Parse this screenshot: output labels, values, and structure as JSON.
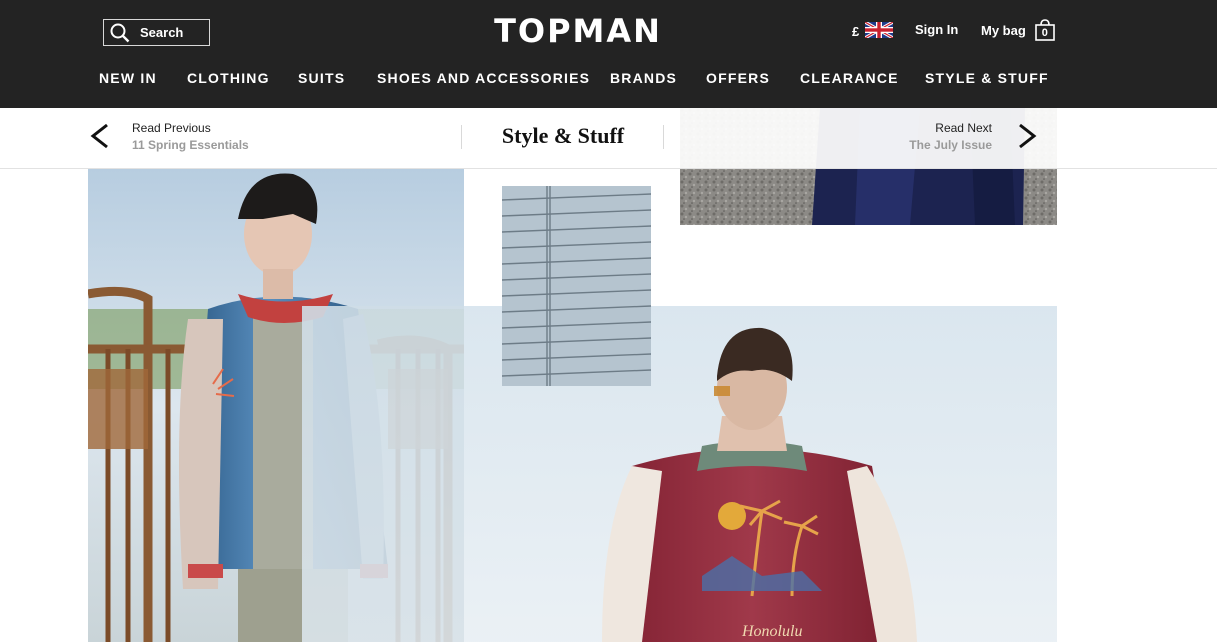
{
  "header": {
    "search_label": "Search",
    "logo": "TOPMAN",
    "currency_symbol": "£",
    "sign_in": "Sign In",
    "my_bag": "My bag",
    "bag_count": "0"
  },
  "nav": {
    "items": [
      {
        "label": "NEW IN"
      },
      {
        "label": "CLOTHING"
      },
      {
        "label": "SUITS"
      },
      {
        "label": "SHOES AND ACCESSORIES"
      },
      {
        "label": "BRANDS"
      },
      {
        "label": "OFFERS"
      },
      {
        "label": "CLEARANCE"
      },
      {
        "label": "STYLE & STUFF"
      }
    ]
  },
  "article_nav": {
    "section_title": "Style & Stuff",
    "previous": {
      "label": "Read Previous",
      "title": "11 Spring Essentials"
    },
    "next": {
      "label": "Read Next",
      "title": "The July Issue"
    }
  },
  "colors": {
    "header_bg": "#232323",
    "jacket_red": "#8e2a3a",
    "jacket_blue": "#3b6d99"
  },
  "icons": [
    "search-icon",
    "uk-flag-icon",
    "bag-icon",
    "chevron-left-icon",
    "chevron-right-icon"
  ]
}
